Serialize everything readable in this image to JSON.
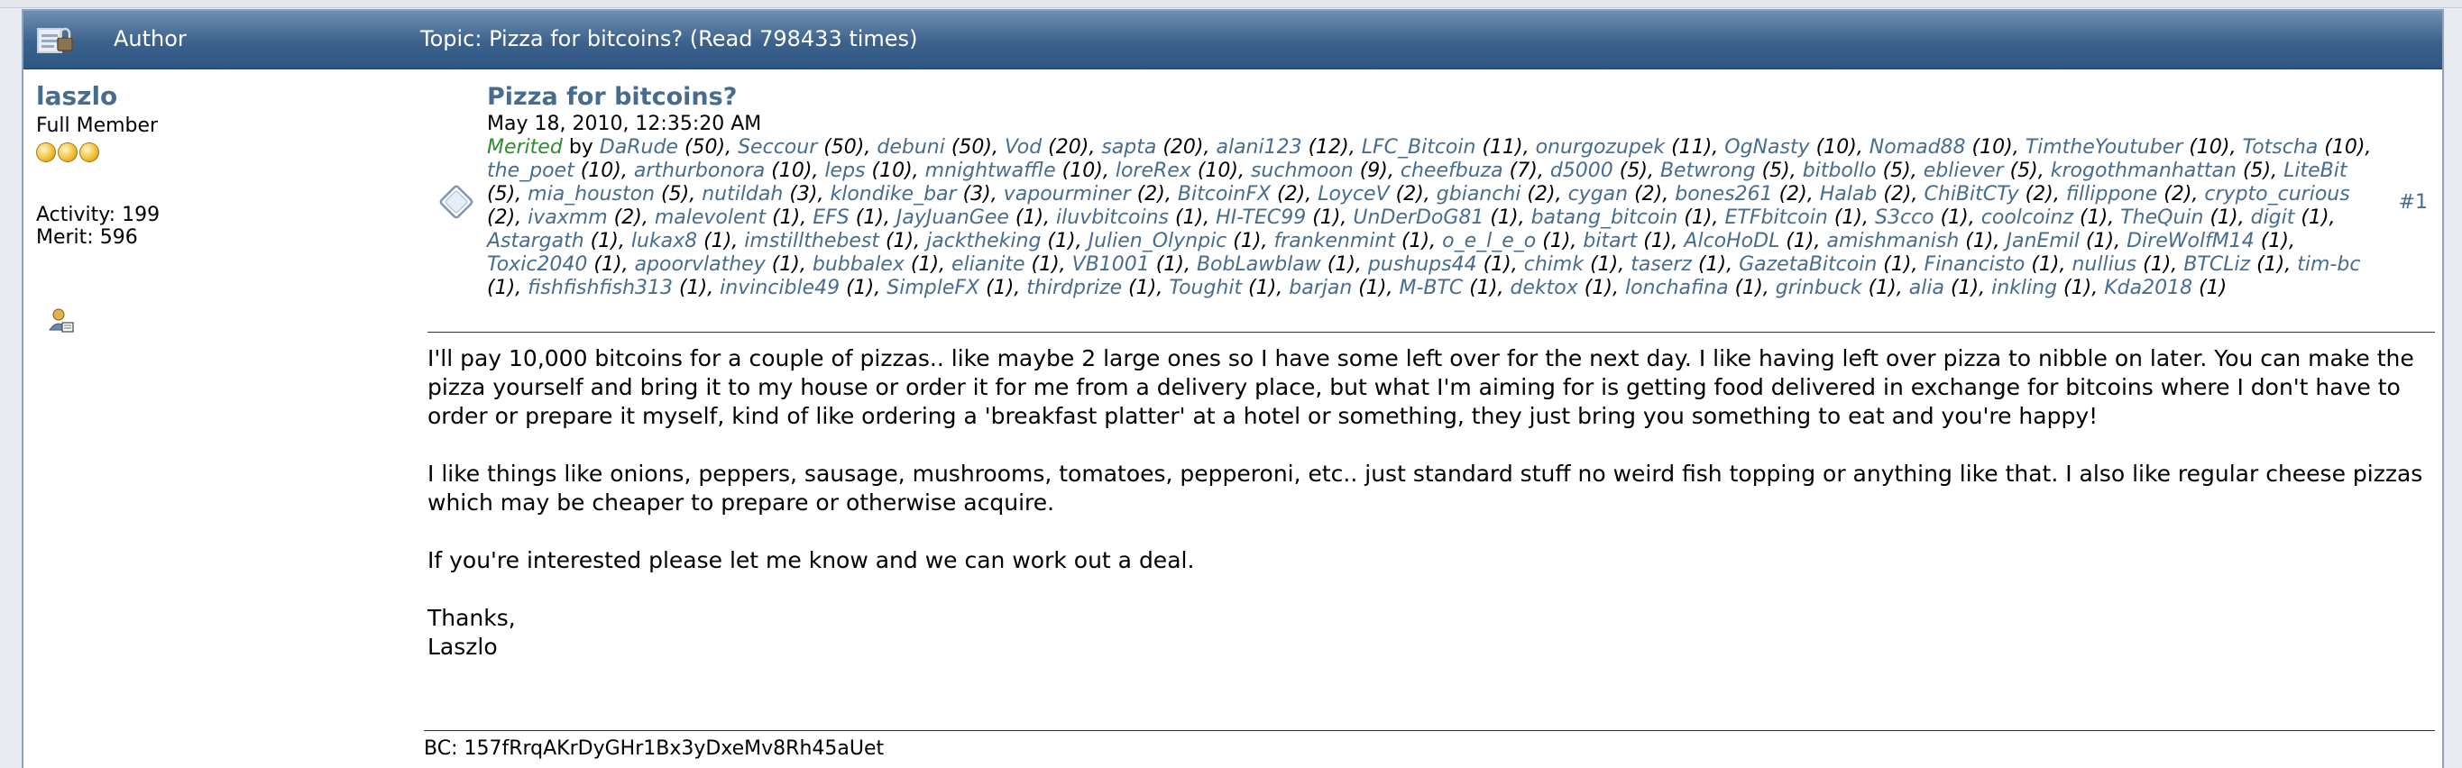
{
  "header": {
    "author_label": "Author",
    "topic_label": "Topic: Pizza for bitcoins?  (Read 798433 times)"
  },
  "poster": {
    "name": "laszlo",
    "rank": "Full Member",
    "activity": "Activity: 199",
    "merit": "Merit: 596"
  },
  "post": {
    "subject": "Pizza for bitcoins?",
    "date": "May 18, 2010, 12:35:20 AM",
    "number": "#1",
    "merited_label": "Merited",
    "by_label": "by",
    "merits": [
      [
        "DaRude",
        "50"
      ],
      [
        "Seccour",
        "50"
      ],
      [
        "debuni",
        "50"
      ],
      [
        "Vod",
        "20"
      ],
      [
        "sapta",
        "20"
      ],
      [
        "alani123",
        "12"
      ],
      [
        "LFC_Bitcoin",
        "11"
      ],
      [
        "onurgozupek",
        "11"
      ],
      [
        "OgNasty",
        "10"
      ],
      [
        "Nomad88",
        "10"
      ],
      [
        "TimtheYoutuber",
        "10"
      ],
      [
        "Totscha",
        "10"
      ],
      [
        "the_poet",
        "10"
      ],
      [
        "arthurbonora",
        "10"
      ],
      [
        "leps",
        "10"
      ],
      [
        "mnightwaffle",
        "10"
      ],
      [
        "loreRex",
        "10"
      ],
      [
        "suchmoon",
        "9"
      ],
      [
        "cheefbuza",
        "7"
      ],
      [
        "d5000",
        "5"
      ],
      [
        "Betwrong",
        "5"
      ],
      [
        "bitbollo",
        "5"
      ],
      [
        "ebliever",
        "5"
      ],
      [
        "krogothmanhattan",
        "5"
      ],
      [
        "LiteBit",
        "5"
      ],
      [
        "mia_houston",
        "5"
      ],
      [
        "nutildah",
        "3"
      ],
      [
        "klondike_bar",
        "3"
      ],
      [
        "vapourminer",
        "2"
      ],
      [
        "BitcoinFX",
        "2"
      ],
      [
        "LoyceV",
        "2"
      ],
      [
        "gbianchi",
        "2"
      ],
      [
        "cygan",
        "2"
      ],
      [
        "bones261",
        "2"
      ],
      [
        "Halab",
        "2"
      ],
      [
        "ChiBitCTy",
        "2"
      ],
      [
        "fillippone",
        "2"
      ],
      [
        "crypto_curious",
        "2"
      ],
      [
        "ivaxmm",
        "2"
      ],
      [
        "malevolent",
        "1"
      ],
      [
        "EFS",
        "1"
      ],
      [
        "JayJuanGee",
        "1"
      ],
      [
        "iluvbitcoins",
        "1"
      ],
      [
        "HI-TEC99",
        "1"
      ],
      [
        "UnDerDoG81",
        "1"
      ],
      [
        "batang_bitcoin",
        "1"
      ],
      [
        "ETFbitcoin",
        "1"
      ],
      [
        "S3cco",
        "1"
      ],
      [
        "coolcoinz",
        "1"
      ],
      [
        "TheQuin",
        "1"
      ],
      [
        "digit",
        "1"
      ],
      [
        "Astargath",
        "1"
      ],
      [
        "lukax8",
        "1"
      ],
      [
        "imstillthebest",
        "1"
      ],
      [
        "jacktheking",
        "1"
      ],
      [
        "Julien_Olynpic",
        "1"
      ],
      [
        "frankenmint",
        "1"
      ],
      [
        "o_e_l_e_o",
        "1"
      ],
      [
        "bitart",
        "1"
      ],
      [
        "AlcoHoDL",
        "1"
      ],
      [
        "amishmanish",
        "1"
      ],
      [
        "JanEmil",
        "1"
      ],
      [
        "DireWolfM14",
        "1"
      ],
      [
        "Toxic2040",
        "1"
      ],
      [
        "apoorvlathey",
        "1"
      ],
      [
        "bubbalex",
        "1"
      ],
      [
        "elianite",
        "1"
      ],
      [
        "VB1001",
        "1"
      ],
      [
        "BobLawblaw",
        "1"
      ],
      [
        "pushups44",
        "1"
      ],
      [
        "chimk",
        "1"
      ],
      [
        "taserz",
        "1"
      ],
      [
        "GazetaBitcoin",
        "1"
      ],
      [
        "Financisto",
        "1"
      ],
      [
        "nullius",
        "1"
      ],
      [
        "BTCLiz",
        "1"
      ],
      [
        "tim-bc",
        "1"
      ],
      [
        "fishfishfish313",
        "1"
      ],
      [
        "invincible49",
        "1"
      ],
      [
        "SimpleFX",
        "1"
      ],
      [
        "thirdprize",
        "1"
      ],
      [
        "Toughit",
        "1"
      ],
      [
        "barjan",
        "1"
      ],
      [
        "M-BTC",
        "1"
      ],
      [
        "dektox",
        "1"
      ],
      [
        "lonchafina",
        "1"
      ],
      [
        "grinbuck",
        "1"
      ],
      [
        "alia",
        "1"
      ],
      [
        "inkling",
        "1"
      ],
      [
        "Kda2018",
        "1"
      ]
    ],
    "body": {
      "p1": "I'll pay 10,000 bitcoins for a couple of pizzas.. like maybe 2 large ones so I have some left over for the next day.  I like having left over pizza to nibble on later.  You can make the pizza yourself and bring it to my house or order it for me from a delivery place, but what I'm aiming for is getting food delivered in exchange for bitcoins where I don't have to order or prepare it myself, kind of like ordering a 'breakfast platter' at a hotel or something, they just bring you something to eat and you're happy!",
      "p2": "I like things like onions, peppers, sausage, mushrooms, tomatoes, pepperoni, etc.. just standard stuff no weird fish topping or anything like that.  I also like regular cheese pizzas which may be cheaper to prepare or otherwise acquire.",
      "p3": "If you're interested please let me know and we can work out a deal.",
      "closing": "Thanks,",
      "signoff": "Laszlo"
    },
    "signature": "BC: 157fRrqAKrDyGHr1Bx3yDxeMv8Rh45aUet"
  },
  "icons": {
    "topic": "locked-topic-icon",
    "post": "message-icon",
    "profile": "profile-icon",
    "stars": "rank-star-icon"
  }
}
